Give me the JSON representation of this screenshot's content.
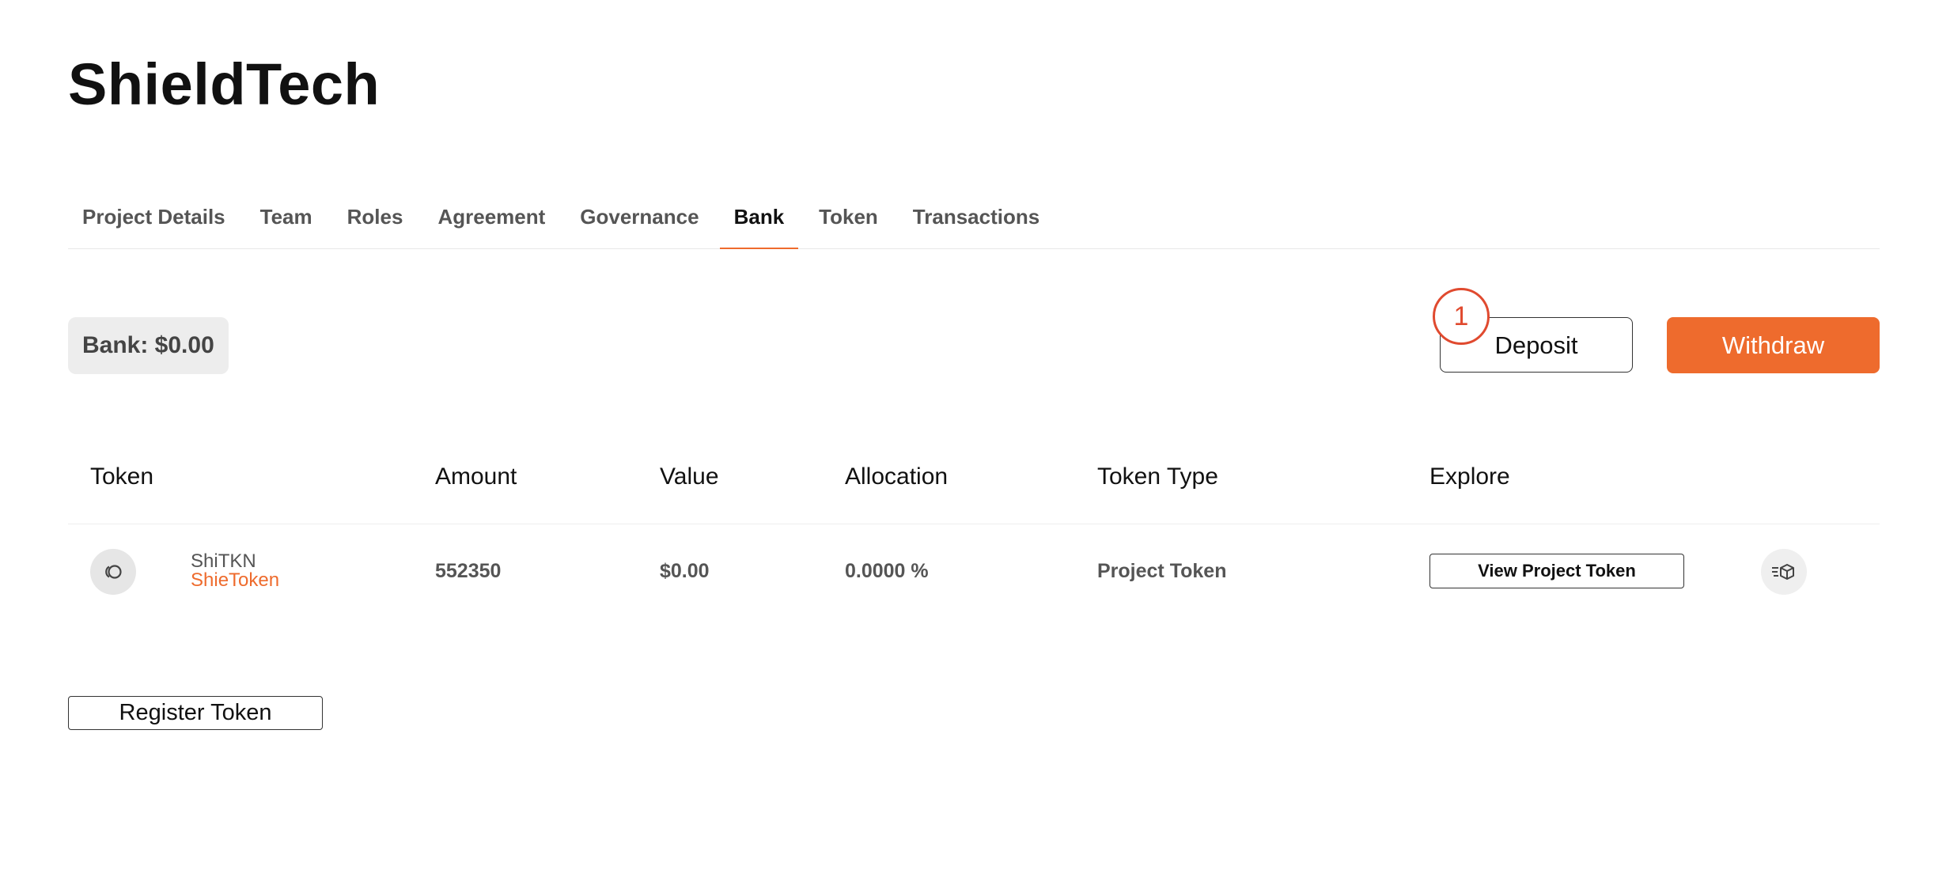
{
  "project": {
    "title": "ShieldTech"
  },
  "tabs": [
    {
      "label": "Project Details",
      "active": false
    },
    {
      "label": "Team",
      "active": false
    },
    {
      "label": "Roles",
      "active": false
    },
    {
      "label": "Agreement",
      "active": false
    },
    {
      "label": "Governance",
      "active": false
    },
    {
      "label": "Bank",
      "active": true
    },
    {
      "label": "Token",
      "active": false
    },
    {
      "label": "Transactions",
      "active": false
    }
  ],
  "bank": {
    "balance_label": "Bank: $0.00",
    "deposit_label": "Deposit",
    "withdraw_label": "Withdraw",
    "step_marker": "1"
  },
  "table": {
    "headers": {
      "token": "Token",
      "amount": "Amount",
      "value": "Value",
      "allocation": "Allocation",
      "token_type": "Token Type",
      "explore": "Explore"
    },
    "rows": [
      {
        "symbol": "ShiTKN",
        "name": "ShieToken",
        "amount": "552350",
        "value": "$0.00",
        "allocation": "0.0000 %",
        "token_type": "Project Token",
        "explore_label": "View Project Token",
        "token_icon": "token-coins-icon",
        "explore_icon": "block-explorer-icon"
      }
    ]
  },
  "register_label": "Register Token",
  "colors": {
    "accent": "#ee6b2d",
    "marker": "#e04a2f",
    "badge_bg": "#ededed"
  }
}
